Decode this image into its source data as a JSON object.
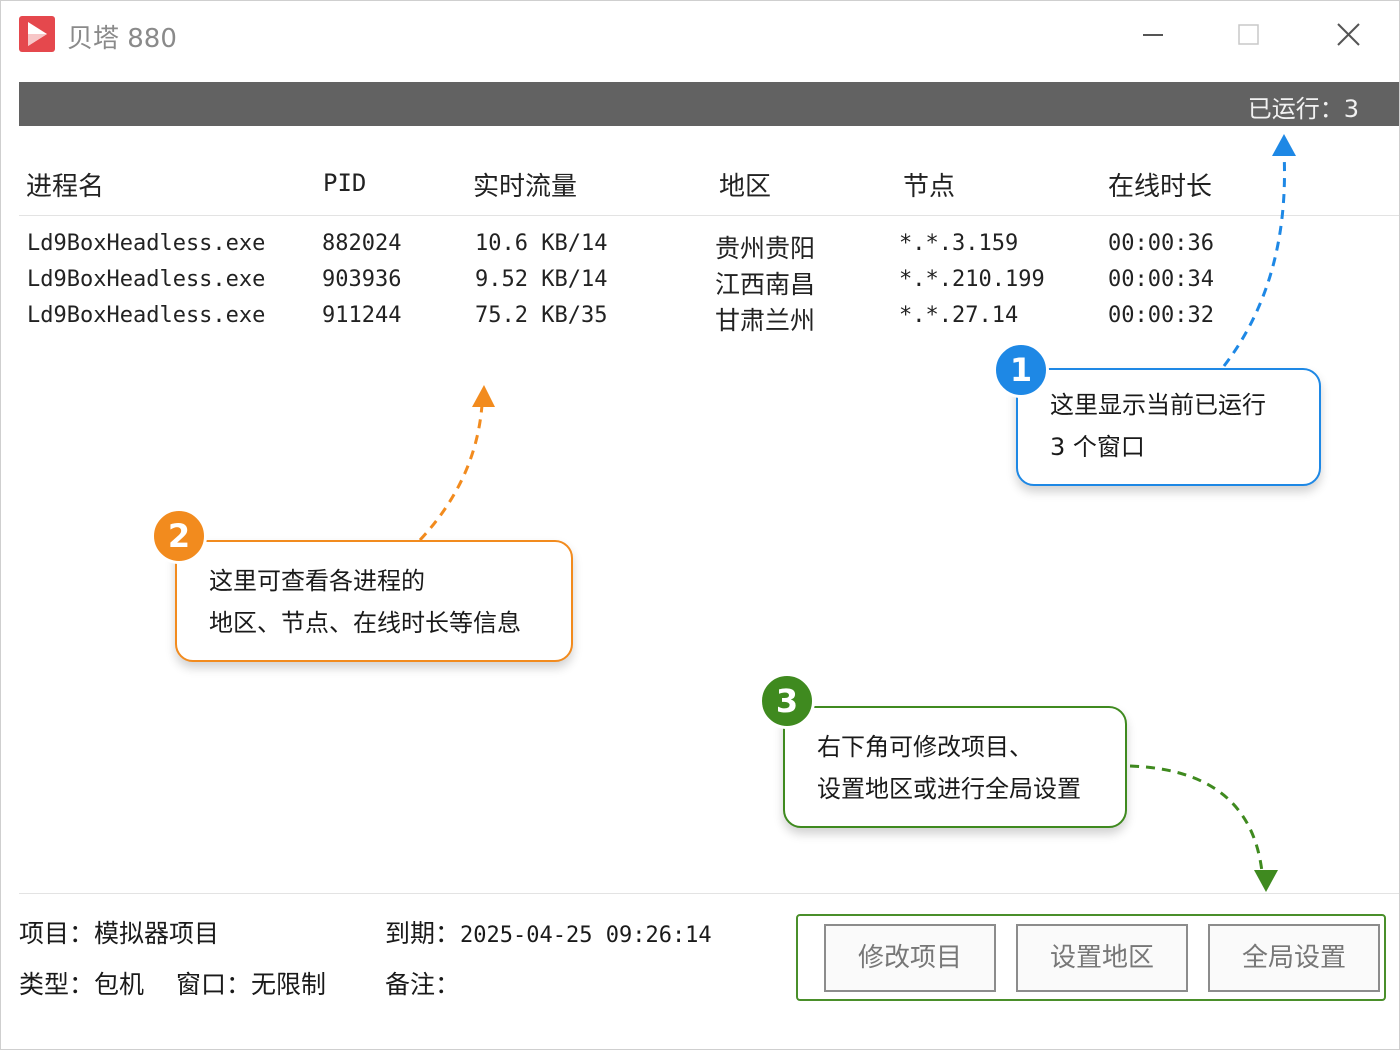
{
  "window": {
    "title": "贝塔 880",
    "running_label": "已运行：3"
  },
  "table": {
    "headers": [
      "进程名",
      "PID",
      "实时流量",
      "地区",
      "节点",
      "在线时长"
    ],
    "rows": [
      [
        "Ld9BoxHeadless.exe",
        "882024",
        "10.6 KB/14",
        "贵州贵阳",
        "*.*.3.159",
        "00:00:36"
      ],
      [
        "Ld9BoxHeadless.exe",
        "903936",
        "9.52 KB/14",
        "江西南昌",
        "*.*.210.199",
        "00:00:34"
      ],
      [
        "Ld9BoxHeadless.exe",
        "911244",
        "75.2 KB/35",
        "甘肃兰州",
        "*.*.27.14",
        "00:00:32"
      ]
    ]
  },
  "footer": {
    "project": "项目：模拟器项目",
    "type_label": "类型：包机",
    "window_label": "窗口：无限制",
    "expiry_label": "到期：",
    "expiry_value": "2025-04-25 09:26:14",
    "note_label": "备注：",
    "buttons": [
      "修改项目",
      "设置地区",
      "全局设置"
    ]
  },
  "callouts": [
    {
      "number": "1",
      "lines": [
        "这里显示当前已运行",
        "3 个窗口"
      ],
      "color": "#1e88e5"
    },
    {
      "number": "2",
      "lines": [
        "这里可查看各进程的",
        "地区、节点、在线时长等信息"
      ],
      "color": "#f28b1e"
    },
    {
      "number": "3",
      "lines": [
        "右下角可修改项目、",
        "设置地区或进行全局设置"
      ],
      "color": "#3f8a1f"
    }
  ],
  "colors": {
    "status_bar": "#626262",
    "logo": "#e5484d"
  }
}
